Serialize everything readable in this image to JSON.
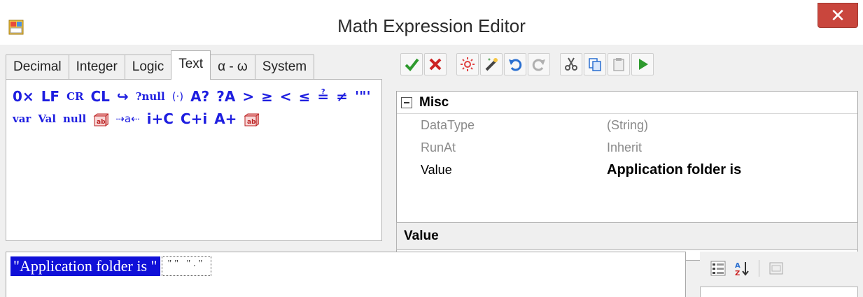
{
  "window": {
    "title": "Math Expression Editor",
    "close_glyph": "✕",
    "app_icon": "app-window-icon"
  },
  "tabs": [
    {
      "label": "Decimal",
      "active": false
    },
    {
      "label": "Integer",
      "active": false
    },
    {
      "label": "Logic",
      "active": false
    },
    {
      "label": "Text",
      "active": true
    },
    {
      "label": "α - ω",
      "active": false
    },
    {
      "label": "System",
      "active": false
    }
  ],
  "symbols": [
    {
      "label": "0×",
      "name": "hex-prefix"
    },
    {
      "label": "LF",
      "name": "line-feed"
    },
    {
      "label": "CR",
      "name": "carriage-return",
      "style": "serif"
    },
    {
      "label": "CL",
      "name": "crlf"
    },
    {
      "label": "↪",
      "name": "new-line"
    },
    {
      "label": "?null",
      "name": "is-null",
      "style": "serif"
    },
    {
      "label": "(·)",
      "name": "parentheses",
      "style": "small"
    },
    {
      "label": "A?",
      "name": "contains"
    },
    {
      "label": "?A",
      "name": "starts-with"
    },
    {
      "label": ">",
      "name": "greater-than"
    },
    {
      "label": "≥",
      "name": "greater-or-equal"
    },
    {
      "label": "<",
      "name": "less-than"
    },
    {
      "label": "≤",
      "name": "less-or-equal"
    },
    {
      "label": "≟",
      "name": "equal"
    },
    {
      "label": "≠",
      "name": "not-equal"
    },
    {
      "label": "'\"'",
      "name": "quote"
    },
    {
      "label": "var",
      "name": "variable",
      "style": "serif"
    },
    {
      "label": "Val",
      "name": "value",
      "style": "serif"
    },
    {
      "label": "null",
      "name": "null-value",
      "style": "serif"
    },
    {
      "label": "",
      "name": "box-icon-a",
      "icon": true
    },
    {
      "label": "⇢a⇠",
      "name": "trim",
      "style": "small"
    },
    {
      "label": "i+C",
      "name": "index-of"
    },
    {
      "label": "C+i",
      "name": "char-at"
    },
    {
      "label": "A+",
      "name": "concat"
    },
    {
      "label": "",
      "name": "box-icon-b",
      "icon": true
    }
  ],
  "toolbar": [
    {
      "name": "ok-check-icon",
      "color": "#2e9a2e"
    },
    {
      "name": "cancel-x-icon",
      "color": "#cc2222"
    },
    {
      "name": "sep"
    },
    {
      "name": "highlight-sun-icon",
      "color": "#e04040"
    },
    {
      "name": "magic-wand-icon",
      "color": "#444444"
    },
    {
      "name": "undo-icon",
      "color": "#2a6fd0"
    },
    {
      "name": "redo-icon",
      "color": "#b0b0b0"
    },
    {
      "name": "sep"
    },
    {
      "name": "cut-icon",
      "color": "#555555"
    },
    {
      "name": "copy-icon",
      "color": "#2a6fd0"
    },
    {
      "name": "paste-icon",
      "color": "#b0b0b0"
    },
    {
      "name": "run-play-icon",
      "color": "#2e9a2e"
    }
  ],
  "property_grid": {
    "category": "Misc",
    "rows": [
      {
        "name": "DataType",
        "value": "(String)",
        "disabled": true
      },
      {
        "name": "RunAt",
        "value": "Inherit",
        "disabled": true
      },
      {
        "name": "Value",
        "value": "Application folder is",
        "disabled": false
      }
    ],
    "description_title": "Value"
  },
  "expression": {
    "token": "\"Application folder is \"",
    "token2": "\"\"  \".\""
  },
  "colors": {
    "selection": "#1010d8",
    "symbol": "#1e1ee0",
    "close": "#c9463d"
  }
}
